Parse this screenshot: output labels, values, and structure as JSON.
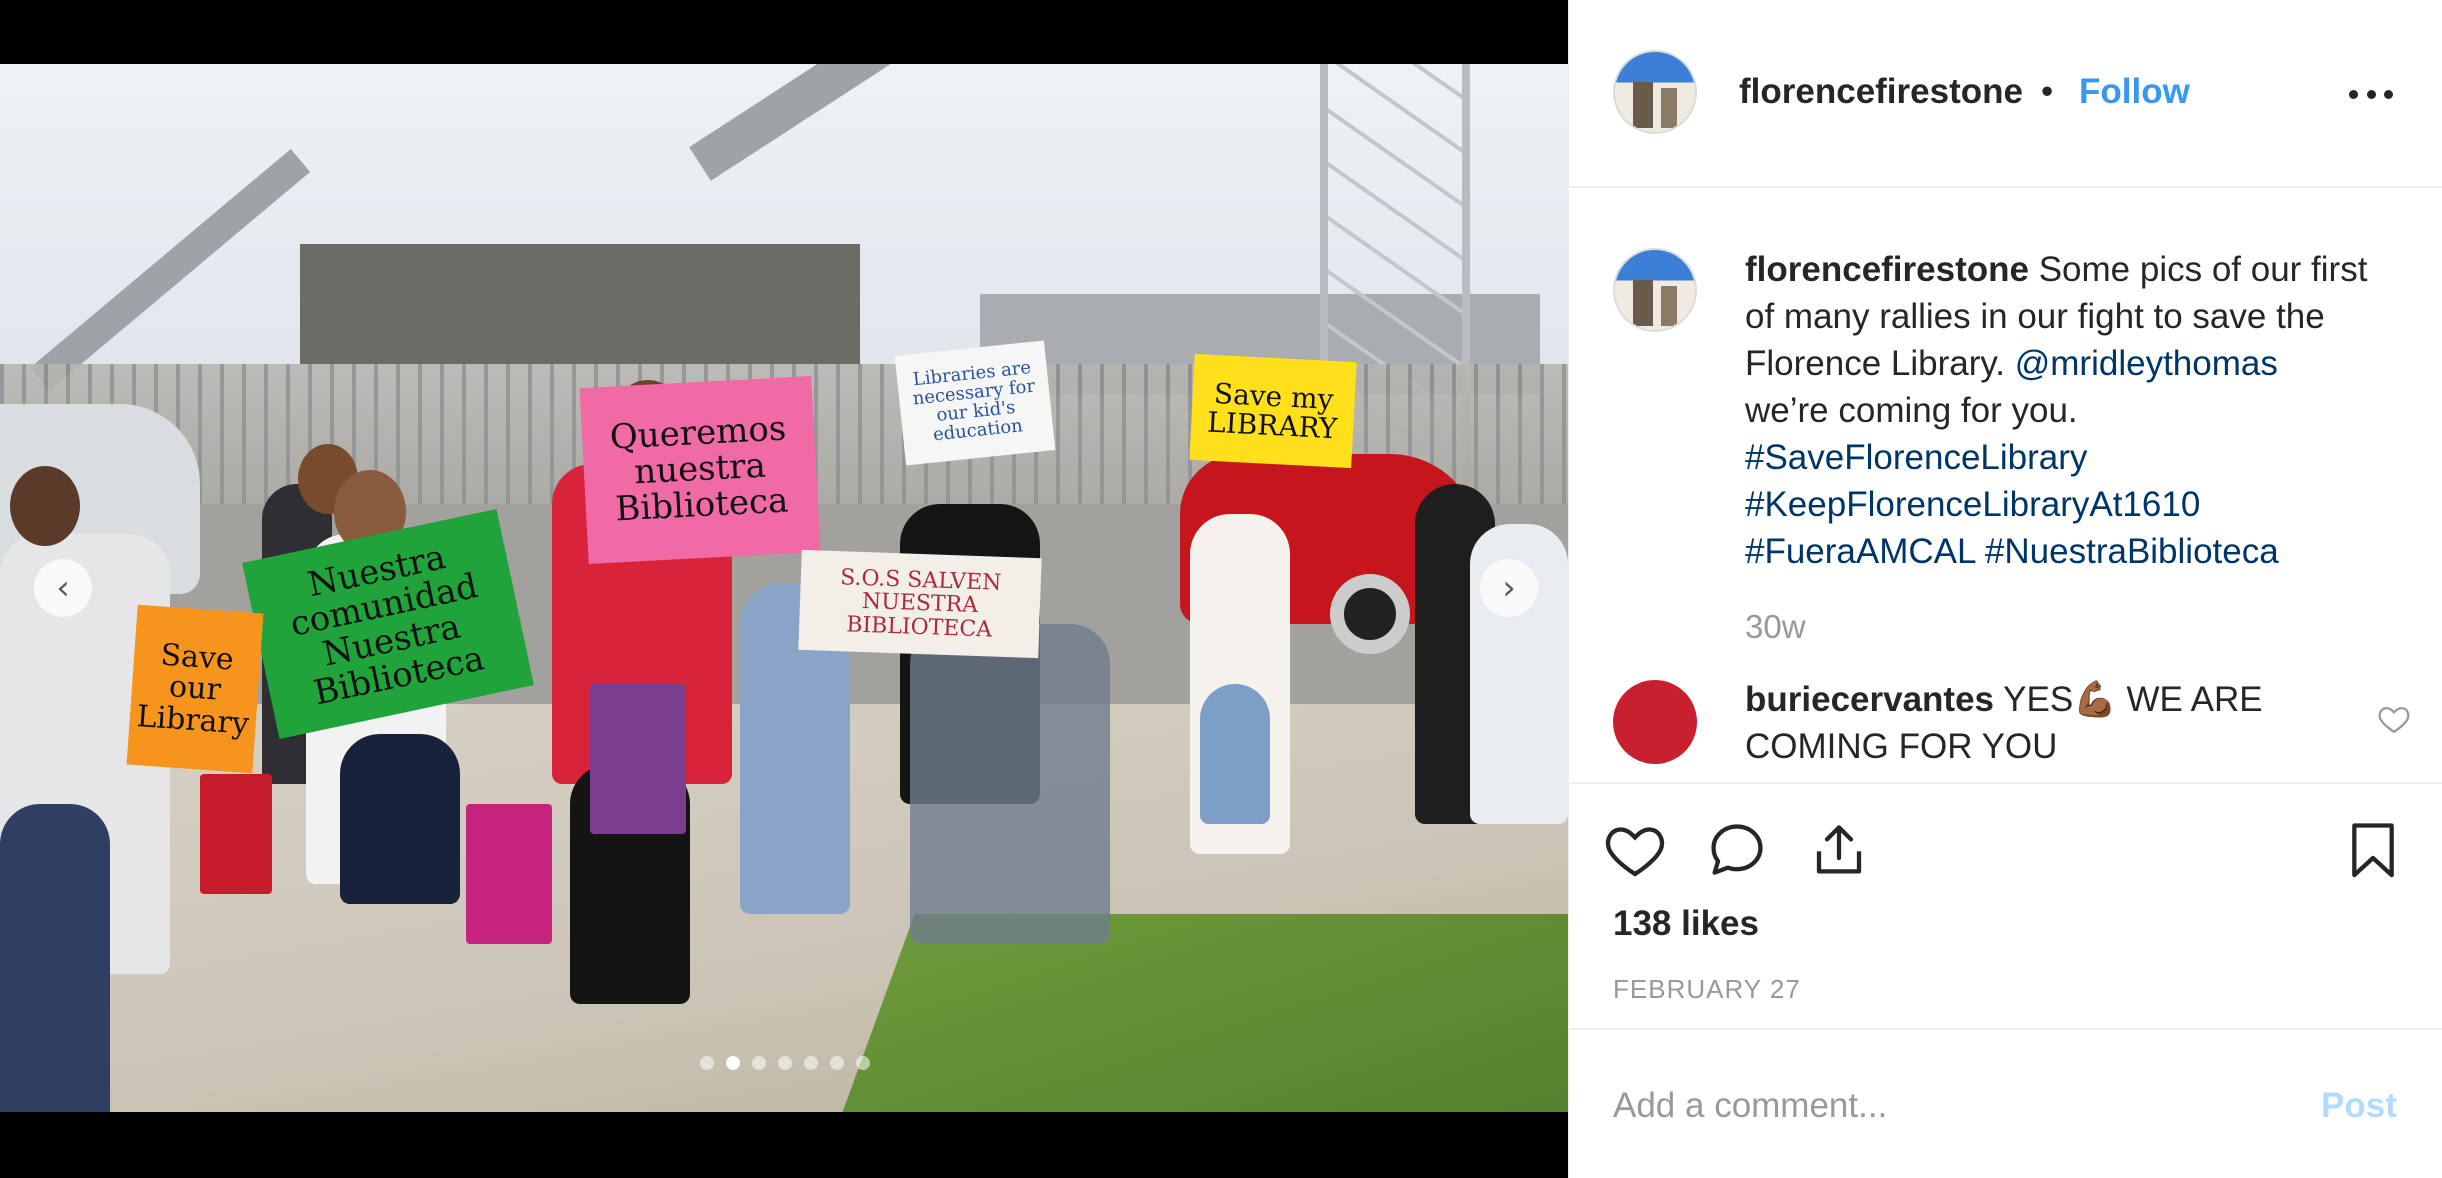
{
  "post": {
    "username": "florencefirestone",
    "bullet": "•",
    "follow_label": "Follow",
    "caption_text": "Some pics of our first of many rallies in our fight to save the Florence Library.",
    "caption_mention": "@mridleythomas",
    "caption_text2": "we’re coming for you.",
    "hashtags": [
      "#SaveFlorenceLibrary",
      "#KeepFlorenceLibraryAt1610",
      "#FueraAMCAL",
      "#NuestraBiblioteca"
    ],
    "time_ago": "30w",
    "likes": "138 likes",
    "date": "FEBRUARY 27"
  },
  "comment": {
    "username": "buriecervantes",
    "text": "YES💪🏾 WE ARE COMING FOR YOU"
  },
  "add_comment": {
    "placeholder": "Add a comment...",
    "post_label": "Post"
  },
  "photo": {
    "carousel_dots": 7,
    "active_dot": 1,
    "signs": {
      "green": "Nuestra comunidad Nuestra Biblioteca",
      "pink": "Queremos nuestra Biblioteca",
      "orange": "Save our Library",
      "white": "Libraries are necessary for our kid's education",
      "yellow": "Save my LIBRARY",
      "sos": "S.O.S SALVEN NUESTRA BIBLIOTECA"
    }
  },
  "icons": {
    "prev": "chevron-left-icon",
    "next": "chevron-right-icon",
    "like": "heart-icon",
    "comment": "comment-bubble-icon",
    "share": "share-icon",
    "save": "bookmark-icon",
    "more": "more-options-icon"
  },
  "colors": {
    "link": "#3897f0",
    "hashtag": "#003569",
    "muted": "#999999",
    "post_disabled": "#b3dbff"
  }
}
